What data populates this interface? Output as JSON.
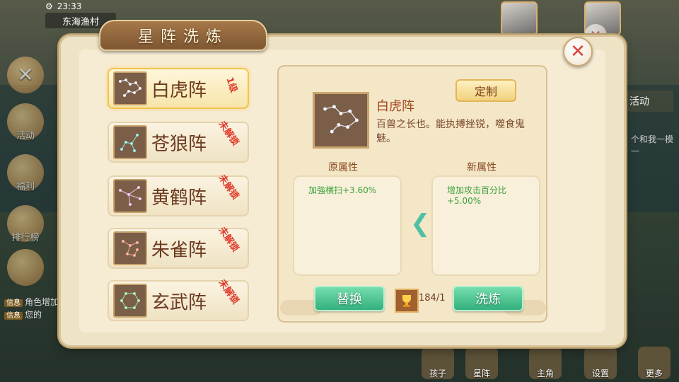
{
  "status_bar": {
    "time": "23:33"
  },
  "location": {
    "name": "东海渔村"
  },
  "side_buttons": [
    {
      "label": "活动"
    },
    {
      "label": "福利"
    },
    {
      "label": "排行榜"
    }
  ],
  "chat": [
    {
      "tag": "信息",
      "text": "角色增加"
    },
    {
      "tag": "信息",
      "text": "您的"
    }
  ],
  "top_right": {
    "activity_tab": "活动",
    "chat_snippet": "个和我一模一"
  },
  "bottom_buttons": [
    {
      "label": "孩子"
    },
    {
      "label": "星阵"
    },
    {
      "label": "主角"
    },
    {
      "label": "设置"
    },
    {
      "label": "更多"
    }
  ],
  "dialog": {
    "title": "星阵洗炼",
    "close_symbol": "✕",
    "formations": [
      {
        "name": "白虎阵",
        "badge": "1级",
        "selected": true
      },
      {
        "name": "苍狼阵",
        "badge": "未解锁",
        "selected": false
      },
      {
        "name": "黄鹤阵",
        "badge": "未解锁",
        "selected": false
      },
      {
        "name": "朱雀阵",
        "badge": "未解锁",
        "selected": false
      },
      {
        "name": "玄武阵",
        "badge": "未解锁",
        "selected": false
      }
    ],
    "detail": {
      "name": "白虎阵",
      "description": "百兽之长也。能执搏挫锐，噬食鬼魅。",
      "custom_button": "定制",
      "old_attr_label": "原属性",
      "old_attr_value": "加強横扫+3.60%",
      "new_attr_label": "新属性",
      "new_attr_value": "增加攻击百分比\n+5.00%",
      "arrow_symbol": "❮",
      "replace_button": "替换",
      "item_count": "184/1",
      "refine_button": "洗炼"
    }
  },
  "colors": {
    "title_text": "#fff4d8",
    "badge_red": "#e03a2c",
    "attr_green": "#3da13c",
    "button_green": "#2fae7a"
  }
}
